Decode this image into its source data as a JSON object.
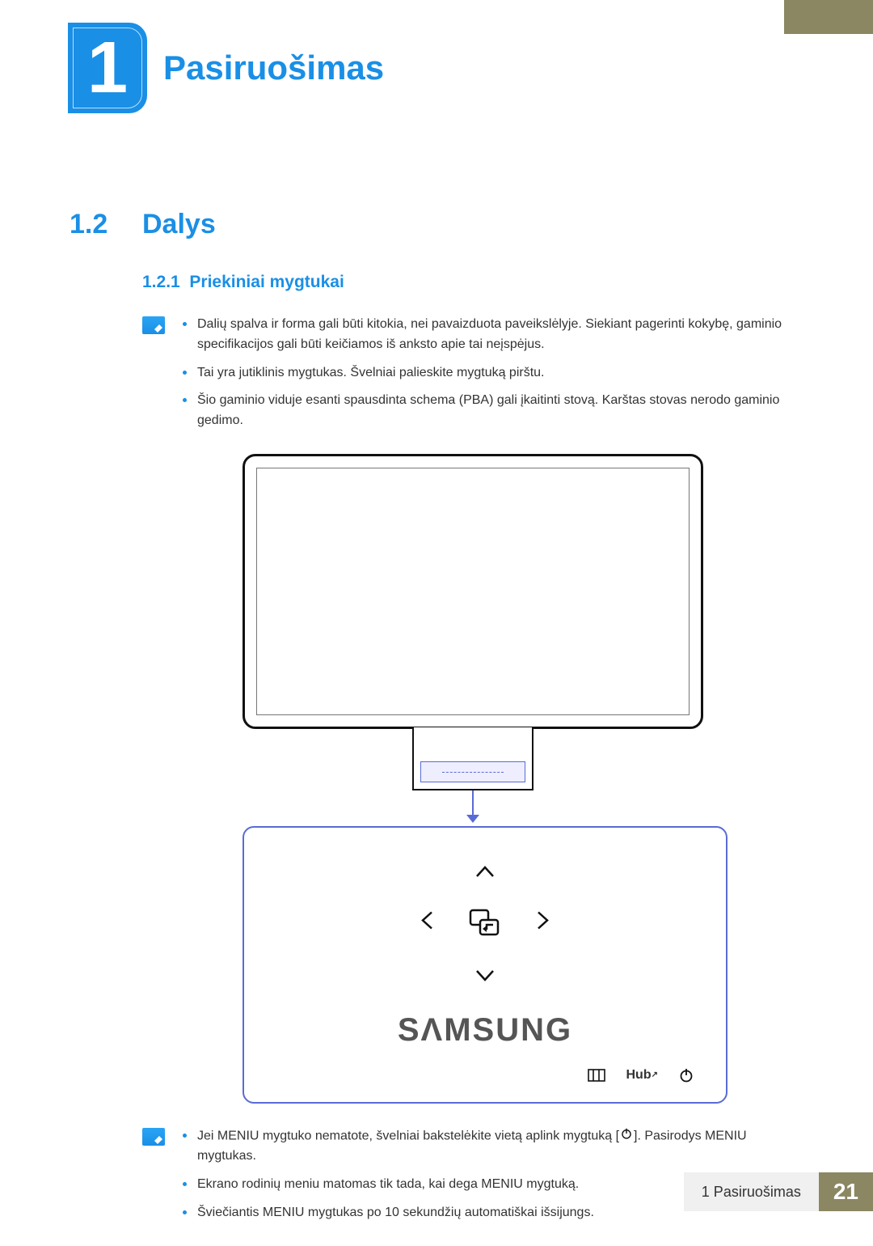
{
  "chapter": {
    "number": "1",
    "title": "Pasiruošimas"
  },
  "section": {
    "number": "1.2",
    "title": "Dalys"
  },
  "subsection": {
    "number": "1.2.1",
    "title": "Priekiniai mygtukai"
  },
  "notes1": {
    "b1": "Dalių spalva ir forma gali būti kitokia, nei pavaizduota paveikslėlyje. Siekiant pagerinti kokybę, gaminio specifikacijos gali būti keičiamos iš anksto apie tai neįspėjus.",
    "b2": "Tai yra jutiklinis mygtukas. Švelniai palieskite mygtuką pirštu.",
    "b3": "Šio gaminio viduje esanti spausdinta schema (PBA) gali įkaitinti stovą. Karštas stovas nerodo gaminio gedimo."
  },
  "notes2": {
    "b1_pre": "Jei MENIU mygtuko nematote, švelniai bakstelėkite vietą aplink mygtuką [",
    "b1_post": "]. Pasirodys MENIU mygtukas.",
    "b2": "Ekrano rodinių meniu matomas tik tada, kai dega MENIU mygtuką.",
    "b3": "Šviečiantis MENIU mygtukas po 10 sekundžių automatiškai išsijungs."
  },
  "brand_text": "SΛMSUNG",
  "panel_icons": {
    "hub": "Hub"
  },
  "footer": {
    "label": "1 Pasiruošimas",
    "page": "21"
  }
}
